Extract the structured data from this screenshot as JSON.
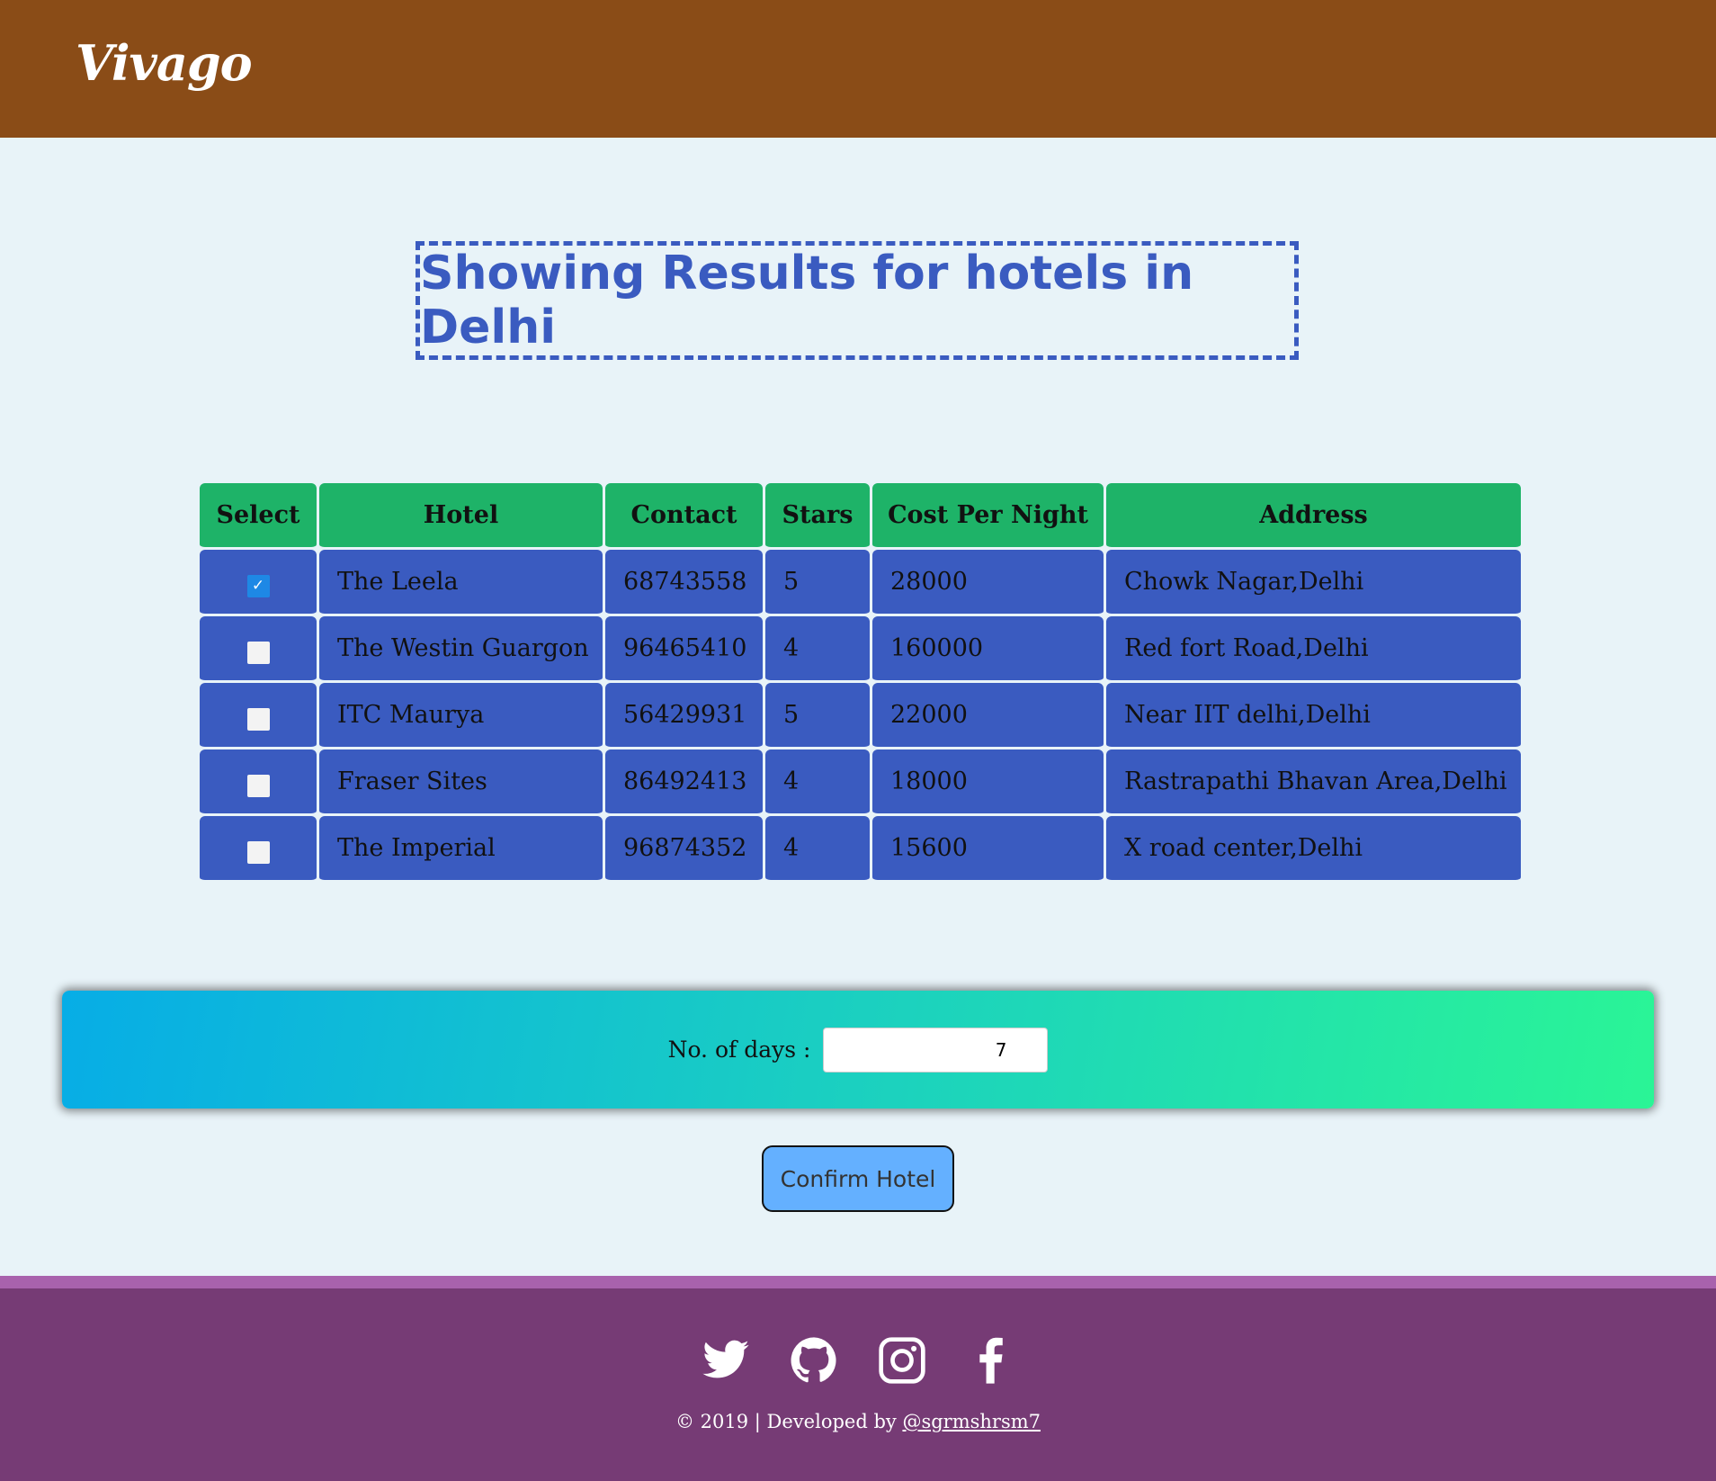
{
  "header": {
    "logo": "Vivago"
  },
  "title": "Showing Results for hotels in Delhi",
  "table": {
    "headers": [
      "Select",
      "Hotel",
      "Contact",
      "Stars",
      "Cost Per Night",
      "Address"
    ],
    "rows": [
      {
        "selected": true,
        "hotel": "The Leela",
        "contact": "68743558",
        "stars": "5",
        "cost": "28000",
        "address": "Chowk Nagar,Delhi"
      },
      {
        "selected": false,
        "hotel": "The Westin Guargon",
        "contact": "96465410",
        "stars": "4",
        "cost": "160000",
        "address": "Red fort Road,Delhi"
      },
      {
        "selected": false,
        "hotel": "ITC Maurya",
        "contact": "56429931",
        "stars": "5",
        "cost": "22000",
        "address": "Near IIT delhi,Delhi"
      },
      {
        "selected": false,
        "hotel": "Fraser Sites",
        "contact": "86492413",
        "stars": "4",
        "cost": "18000",
        "address": "Rastrapathi Bhavan Area,Delhi"
      },
      {
        "selected": false,
        "hotel": "The Imperial",
        "contact": "96874352",
        "stars": "4",
        "cost": "15600",
        "address": "X road center,Delhi"
      }
    ]
  },
  "days": {
    "label": "No. of days :",
    "value": "7"
  },
  "confirm_label": "Confirm Hotel",
  "footer": {
    "icons": [
      "twitter-icon",
      "github-icon",
      "instagram-icon",
      "facebook-icon"
    ],
    "copyright": "© 2019 | Developed by ",
    "author": "@sgrmshrsm7"
  }
}
